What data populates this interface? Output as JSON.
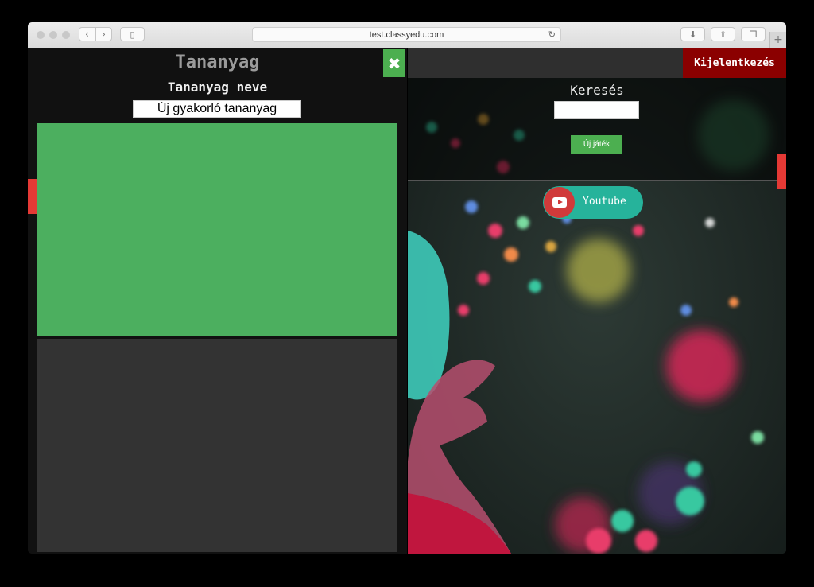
{
  "browser": {
    "url": "test.classyedu.com"
  },
  "left_panel": {
    "title": "Tananyag",
    "name_label": "Tananyag neve",
    "name_value": "Új gyakorló tananyag",
    "close_icon": "close-icon",
    "accent_color": "#4caf50"
  },
  "right_panel": {
    "logout_label": "Kijelentkezés",
    "search_label": "Keresés",
    "search_value": "",
    "new_game_label": "Új játék",
    "youtube_label": "Youtube",
    "logout_color": "#8b0000",
    "youtube_color": "#26b39b"
  }
}
